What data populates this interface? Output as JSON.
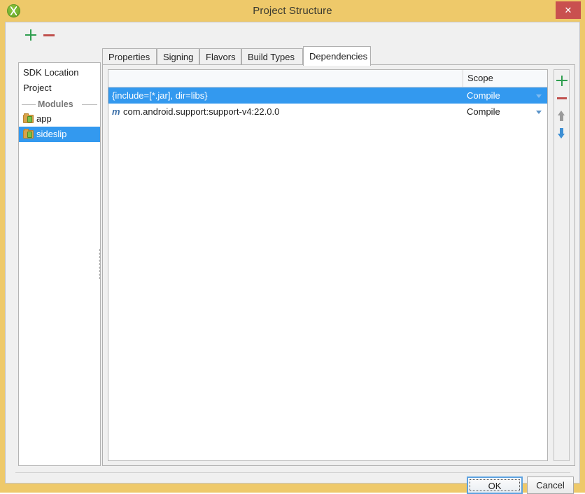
{
  "window": {
    "title": "Project Structure",
    "app_icon": "android-studio-icon",
    "close_label": "✕"
  },
  "sidebar": {
    "toolbar": {
      "add_label": "+",
      "remove_label": "−"
    },
    "entries": [
      {
        "label": "SDK Location",
        "type": "item",
        "selected": false
      },
      {
        "label": "Project",
        "type": "item",
        "selected": false
      }
    ],
    "group_label": "Modules",
    "modules": [
      {
        "label": "app",
        "selected": false
      },
      {
        "label": "sideslip",
        "selected": true
      }
    ]
  },
  "tabs": [
    {
      "label": "Properties",
      "active": false
    },
    {
      "label": "Signing",
      "active": false
    },
    {
      "label": "Flavors",
      "active": false
    },
    {
      "label": "Build Types",
      "active": false
    },
    {
      "label": "Dependencies",
      "active": true
    }
  ],
  "table": {
    "headers": {
      "name": "",
      "scope": "Scope"
    },
    "rows": [
      {
        "name": "{include=[*.jar], dir=libs}",
        "scope": "Compile",
        "icon": "",
        "selected": true
      },
      {
        "name": "com.android.support:support-v4:22.0.0",
        "scope": "Compile",
        "icon": "m",
        "selected": false
      }
    ]
  },
  "side_buttons": [
    {
      "name": "add",
      "label": "+"
    },
    {
      "name": "remove",
      "label": "−"
    },
    {
      "name": "move-up",
      "label": "↑"
    },
    {
      "name": "move-down",
      "label": "↓"
    }
  ],
  "footer": {
    "ok_label": "OK",
    "cancel_label": "Cancel"
  },
  "colors": {
    "titlebar": "#eec96a",
    "selection": "#3399ef",
    "close": "#c9504f",
    "accent_green": "#2f9e4f",
    "accent_red": "#c0504d",
    "accent_blue": "#3d8fd4"
  }
}
